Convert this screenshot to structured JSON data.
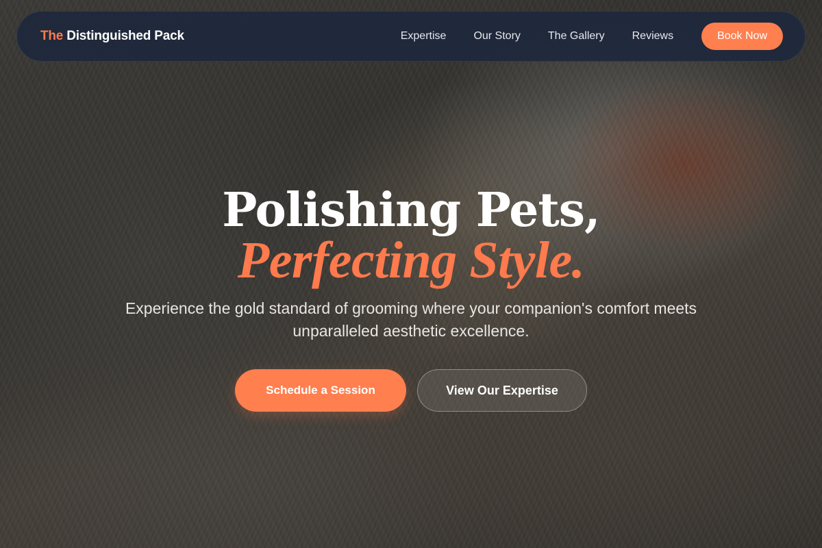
{
  "brand": {
    "accent": "The",
    "name": "Distinguished Pack"
  },
  "nav": {
    "links": [
      "Expertise",
      "Our Story",
      "The Gallery",
      "Reviews"
    ],
    "cta": "Book Now"
  },
  "hero": {
    "headline_line1": "Polishing Pets,",
    "headline_line2": "Perfecting Style.",
    "subtitle": "Experience the gold standard of grooming where your companion's comfort meets unparalleled aesthetic excellence.",
    "primary_cta": "Schedule a Session",
    "secondary_cta": "View Our Expertise"
  },
  "colors": {
    "accent": "#ff7a4d",
    "navbar": "#1e283c"
  }
}
